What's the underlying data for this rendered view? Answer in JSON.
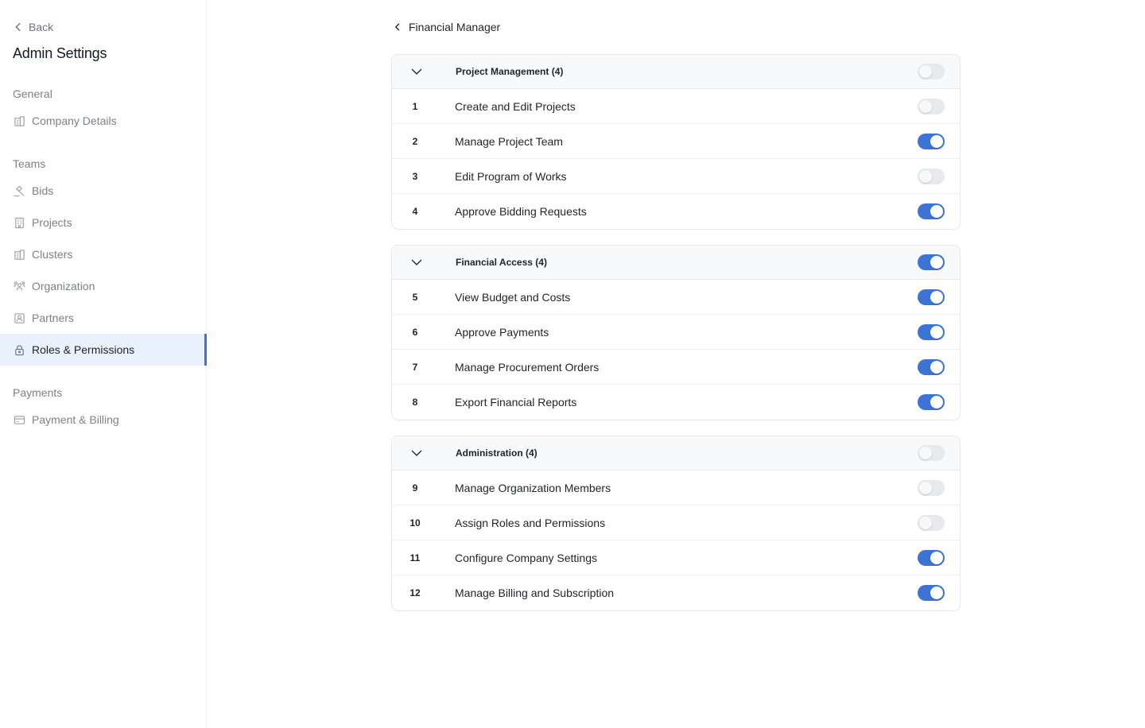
{
  "sidebar": {
    "back_label": "Back",
    "title": "Admin Settings",
    "sections": [
      {
        "label": "General",
        "items": [
          {
            "label": "Company Details",
            "icon": "building-icon"
          }
        ]
      },
      {
        "label": "Teams",
        "items": [
          {
            "label": "Bids",
            "icon": "gavel-icon"
          },
          {
            "label": "Projects",
            "icon": "office-building-icon"
          },
          {
            "label": "Clusters",
            "icon": "building-icon"
          },
          {
            "label": "Organization",
            "icon": "users-icon"
          },
          {
            "label": "Partners",
            "icon": "contact-card-icon"
          },
          {
            "label": "Roles & Permissions",
            "icon": "lock-icon",
            "active": true
          }
        ]
      },
      {
        "label": "Payments",
        "items": [
          {
            "label": "Payment & Billing",
            "icon": "credit-card-icon"
          }
        ]
      }
    ]
  },
  "main": {
    "breadcrumb": "Financial Manager",
    "groups": [
      {
        "title": "Project Management (4)",
        "enabled": false,
        "permissions": [
          {
            "num": "1",
            "label": "Create and Edit Projects",
            "enabled": false
          },
          {
            "num": "2",
            "label": "Manage Project Team",
            "enabled": true
          },
          {
            "num": "3",
            "label": "Edit Program of Works",
            "enabled": false
          },
          {
            "num": "4",
            "label": "Approve Bidding Requests",
            "enabled": true
          }
        ]
      },
      {
        "title": "Financial Access (4)",
        "enabled": true,
        "permissions": [
          {
            "num": "5",
            "label": "View Budget and Costs",
            "enabled": true
          },
          {
            "num": "6",
            "label": "Approve Payments",
            "enabled": true
          },
          {
            "num": "7",
            "label": "Manage Procurement Orders",
            "enabled": true
          },
          {
            "num": "8",
            "label": "Export Financial Reports",
            "enabled": true
          }
        ]
      },
      {
        "title": "Administration (4)",
        "enabled": false,
        "permissions": [
          {
            "num": "9",
            "label": "Manage Organization Members",
            "enabled": false
          },
          {
            "num": "10",
            "label": "Assign Roles and Permissions",
            "enabled": false
          },
          {
            "num": "11",
            "label": "Configure Company Settings",
            "enabled": true
          },
          {
            "num": "12",
            "label": "Manage Billing and Subscription",
            "enabled": true
          }
        ]
      }
    ]
  },
  "colors": {
    "accent": "#3c74d6",
    "active_bg": "#e9f1fc",
    "toggle_off": "#e7e9ec"
  }
}
